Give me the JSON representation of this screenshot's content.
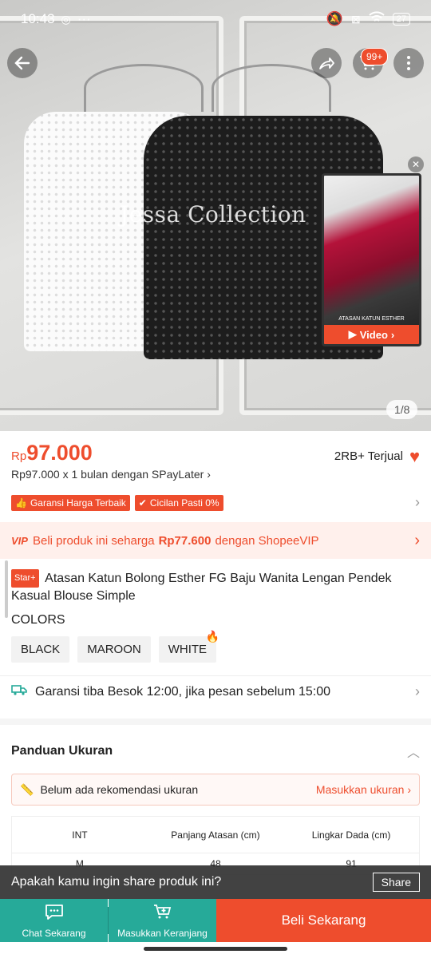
{
  "status_bar": {
    "time": "10:43",
    "battery": "27"
  },
  "hero": {
    "watermark": "Jessa Collection",
    "cart_badge": "99+",
    "video_caption": "ATASAN KATUN ESTHER",
    "video_label": "Video",
    "page_counter": "1/8"
  },
  "price": {
    "currency": "Rp",
    "value": "97.000",
    "sold": "2RB+ Terjual",
    "paylater": "Rp97.000 x 1 bulan dengan SPayLater"
  },
  "badges": [
    "Garansi Harga Terbaik",
    "Cicilan Pasti 0%"
  ],
  "vip": {
    "tag": "VIP",
    "text_before": "Beli produk ini seharga",
    "price": "Rp77.600",
    "text_after": "dengan ShopeeVIP"
  },
  "product": {
    "tag": "Star+",
    "title": "Atasan Katun Bolong Esther FG Baju Wanita Lengan Pendek Kasual Blouse Simple"
  },
  "colors": {
    "label": "COLORS",
    "options": [
      "BLACK",
      "MAROON",
      "WHITE"
    ]
  },
  "delivery": {
    "text": "Garansi tiba Besok 12:00, jika pesan sebelum 15:00"
  },
  "size_guide": {
    "title": "Panduan Ukuran",
    "reco_text": "Belum ada rekomendasi ukuran",
    "reco_link": "Masukkan ukuran",
    "headers": [
      "INT",
      "Panjang Atasan (cm)",
      "Lingkar Dada (cm)"
    ],
    "rows": [
      [
        "M",
        "48",
        "91"
      ]
    ]
  },
  "share": {
    "prompt": "Apakah kamu ingin share produk ini?",
    "button": "Share"
  },
  "bottom_bar": {
    "chat": "Chat Sekarang",
    "add_cart": "Masukkan Keranjang",
    "buy": "Beli Sekarang"
  },
  "colors_theme": {
    "accent": "#ee4d2d",
    "teal": "#26aa99"
  }
}
